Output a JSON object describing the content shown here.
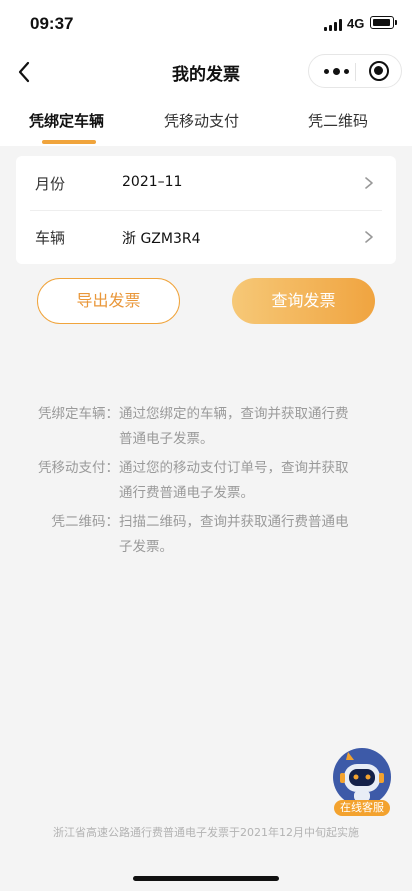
{
  "status_bar": {
    "time": "09:37",
    "network": "4G"
  },
  "nav": {
    "title": "我的发票"
  },
  "tabs": [
    {
      "label": "凭绑定车辆",
      "active": true
    },
    {
      "label": "凭移动支付",
      "active": false
    },
    {
      "label": "凭二维码",
      "active": false
    }
  ],
  "form": {
    "month": {
      "label": "月份",
      "value": "2021–11"
    },
    "vehicle": {
      "label": "车辆",
      "value": "浙 GZM3R4"
    }
  },
  "buttons": {
    "export": "导出发票",
    "query": "查询发票"
  },
  "descriptions": [
    {
      "key": "凭绑定车辆：",
      "lines": [
        "通过您绑定的车辆，查询并获取通行费",
        "普通电子发票。"
      ]
    },
    {
      "key": "凭移动支付：",
      "lines": [
        "通过您的移动支付订单号，查询并获取",
        "通行费普通电子发票。"
      ]
    },
    {
      "key": "凭二维码：",
      "lines": [
        "扫描二维码，查询并获取通行费普通电",
        "子发票。"
      ]
    }
  ],
  "service": {
    "label": "在线客服"
  },
  "footer": {
    "note": "浙江省高速公路通行费普通电子发票于2021年12月中旬起实施"
  },
  "colors": {
    "accent": "#f0a43c",
    "muted_text": "#9a9a9a",
    "background": "#f4f4f4"
  }
}
